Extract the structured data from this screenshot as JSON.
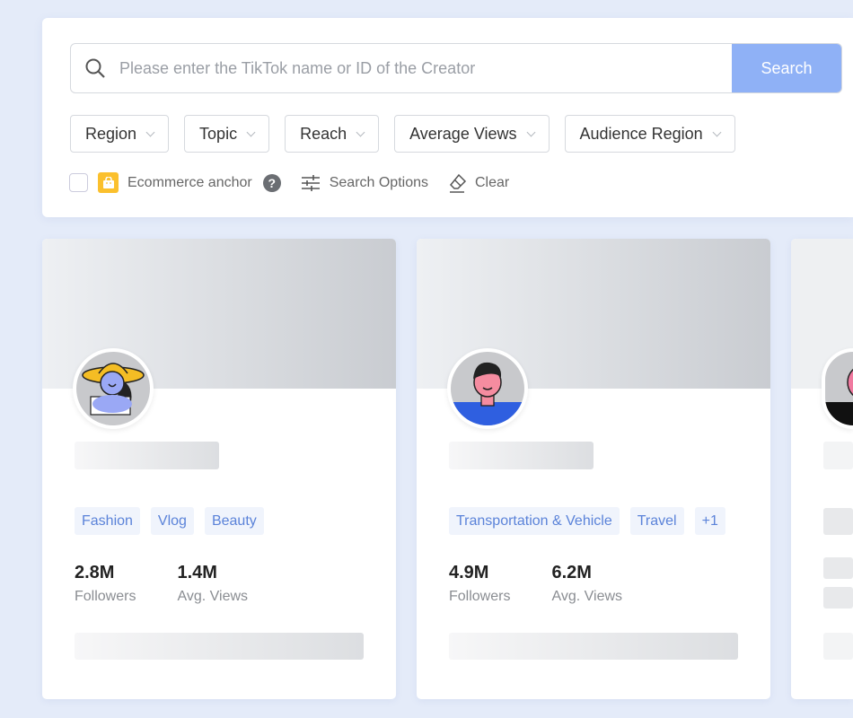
{
  "search": {
    "placeholder": "Please enter the TikTok name or ID of the Creator",
    "button": "Search"
  },
  "filters": [
    "Region",
    "Topic",
    "Reach",
    "Average Views",
    "Audience Region"
  ],
  "options": {
    "ecommerce": "Ecommerce anchor",
    "search_options": "Search Options",
    "clear": "Clear"
  },
  "colors": {
    "accent": "#8fb1f6",
    "tag_text": "#5b83d9",
    "tag_bg": "#f0f4fc"
  },
  "cards": [
    {
      "tags": [
        "Fashion",
        "Vlog",
        "Beauty"
      ],
      "followers": "2.8M",
      "followers_label": "Followers",
      "views": "1.4M",
      "views_label": "Avg. Views"
    },
    {
      "tags": [
        "Transportation & Vehicle",
        "Travel",
        "+1"
      ],
      "followers": "4.9M",
      "followers_label": "Followers",
      "views": "6.2M",
      "views_label": "Avg. Views"
    }
  ]
}
